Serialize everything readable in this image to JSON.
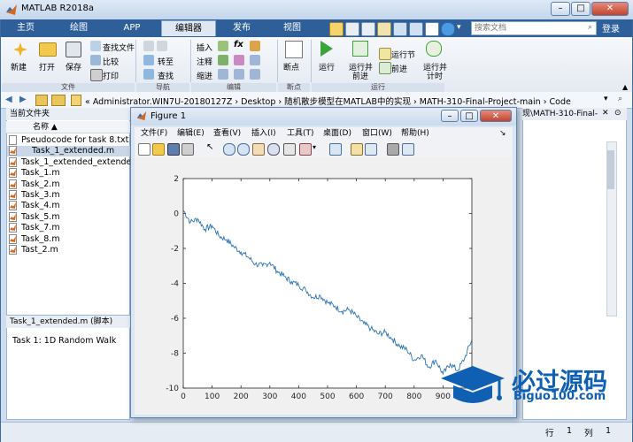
{
  "window": {
    "title": "MATLAB R2018a"
  },
  "tabs": [
    {
      "label": "主页"
    },
    {
      "label": "绘图"
    },
    {
      "label": "APP"
    },
    {
      "label": "编辑器"
    },
    {
      "label": "发布"
    },
    {
      "label": "视图"
    }
  ],
  "search": {
    "placeholder": "搜索文档"
  },
  "login": "登录",
  "ribbon": {
    "file": {
      "new": "新建",
      "open": "打开",
      "save": "保存",
      "find_files": "查找文件",
      "compare": "比较",
      "print": "打印",
      "group": "文件"
    },
    "navigate": {
      "goto": "转至",
      "find": "查找",
      "group": "导航"
    },
    "edit": {
      "insert": "插入",
      "comment": "注释",
      "indent": "缩进",
      "fx": "fx",
      "group": "编辑"
    },
    "breakpoints": {
      "breakpoints": "断点",
      "group": "断点"
    },
    "run": {
      "run": "运行",
      "run_advance_1": "运行并",
      "run_advance_2": "前进",
      "run_section": "运行节",
      "advance": "前进",
      "run_time_1": "运行并",
      "run_time_2": "计时",
      "group": "运行"
    }
  },
  "address": {
    "path": "« Administrator.WIN7U-20180127Z › Desktop › 随机散步模型在MATLAB中的实现 › MATH-310-Final-Project-main › Code"
  },
  "current_folder": {
    "title": "当前文件夹",
    "column": "名称 ▲",
    "files": [
      {
        "name": "Pseudocode for task 8.txt"
      },
      {
        "name": "Task_1_extended.m"
      },
      {
        "name": "Task_1_extended_extended.m"
      },
      {
        "name": "Task_1.m"
      },
      {
        "name": "Task_2.m"
      },
      {
        "name": "Task_3.m"
      },
      {
        "name": "Task_4.m"
      },
      {
        "name": "Task_5.m"
      },
      {
        "name": "Task_7.m"
      },
      {
        "name": "Task_8.m"
      },
      {
        "name": "Tast_2.m"
      }
    ]
  },
  "details": {
    "header": "Task_1_extended.m (脚本)",
    "description": "Task 1: 1D Random Walk"
  },
  "editor": {
    "tab_label": "现\\MATH-310-Final-"
  },
  "statusbar": {
    "row_label": "行",
    "row": "1",
    "col_label": "列",
    "col": "1"
  },
  "figure": {
    "title": "Figure 1",
    "menu": [
      "文件(F)",
      "编辑(E)",
      "查看(V)",
      "插入(I)",
      "工具(T)",
      "桌面(D)",
      "窗口(W)",
      "帮助(H)"
    ]
  },
  "chart_data": {
    "type": "line",
    "x": [
      0,
      25,
      50,
      75,
      100,
      125,
      150,
      175,
      200,
      225,
      250,
      275,
      300,
      325,
      350,
      375,
      400,
      425,
      450,
      475,
      500,
      525,
      550,
      575,
      600,
      625,
      650,
      675,
      700,
      725,
      750,
      775,
      800,
      825,
      850,
      875,
      900,
      925,
      950,
      975,
      1000
    ],
    "series": [
      {
        "values": [
          0.2,
          -0.5,
          -0.3,
          -0.9,
          -0.7,
          -1.3,
          -1.5,
          -1.9,
          -2.2,
          -2.5,
          -2.9,
          -3.0,
          -2.8,
          -3.3,
          -3.6,
          -3.9,
          -4.1,
          -4.4,
          -4.8,
          -4.7,
          -5.1,
          -5.3,
          -5.6,
          -5.5,
          -5.9,
          -6.3,
          -6.6,
          -6.9,
          -6.8,
          -7.2,
          -7.6,
          -7.8,
          -8.4,
          -8.1,
          -8.8,
          -8.4,
          -9.2,
          -8.6,
          -9.0,
          -8.3,
          -7.2
        ],
        "color": "#2e74b5"
      }
    ],
    "xlim": [
      0,
      1000
    ],
    "ylim": [
      -10,
      2
    ],
    "xticks": [
      0,
      100,
      200,
      300,
      400,
      500,
      600,
      700,
      800,
      900
    ],
    "yticks": [
      2,
      0,
      -2,
      -4,
      -6,
      -8,
      -10
    ],
    "grid": false
  },
  "watermark": {
    "title": "必过源码",
    "url": "Biguo100.com"
  },
  "colors": {
    "tabbar": "#2e5f98",
    "line": "#2e74b5"
  }
}
